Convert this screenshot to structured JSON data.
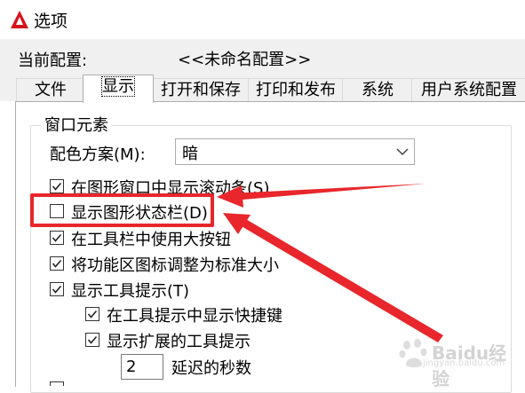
{
  "window": {
    "title": "选项"
  },
  "profile": {
    "label": "当前配置:",
    "value": "<<未命名配置>>"
  },
  "tabs": [
    {
      "label": "文件"
    },
    {
      "label": "显示",
      "active": true
    },
    {
      "label": "打开和保存"
    },
    {
      "label": "打印和发布"
    },
    {
      "label": "系统"
    },
    {
      "label": "用户系统配置"
    }
  ],
  "window_elements": {
    "group_title": "窗口元素",
    "color_scheme": {
      "label": "配色方案(M):",
      "value": "暗"
    },
    "checkboxes": [
      {
        "label": "在图形窗口中显示滚动条(S)",
        "checked": true
      },
      {
        "label": "显示图形状态栏(D)",
        "checked": false
      },
      {
        "label": "在工具栏中使用大按钮",
        "checked": true
      },
      {
        "label": "将功能区图标调整为标准大小",
        "checked": true
      },
      {
        "label": "显示工具提示(T)",
        "checked": true
      },
      {
        "label": "在工具提示中显示快捷键",
        "checked": true
      },
      {
        "label": "显示扩展的工具提示",
        "checked": true
      }
    ],
    "delay": {
      "value": "2",
      "label": "延迟的秒数"
    }
  },
  "watermark": {
    "text": "Baidu经验",
    "sub": "jingyan.baidu.com"
  },
  "colors": {
    "annotation_red": "#e8262b",
    "app_icon_red": "#d4141b"
  }
}
